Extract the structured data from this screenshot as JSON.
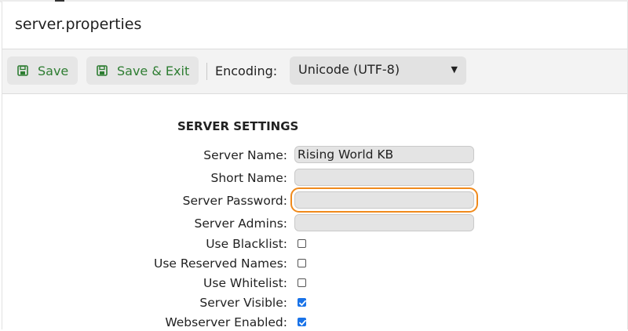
{
  "window": {
    "title": "server.properties"
  },
  "toolbar": {
    "save_label": "Save",
    "save_exit_label": "Save & Exit",
    "encoding_label": "Encoding:",
    "encoding_value": "Unicode (UTF-8)",
    "save_icon": "floppy-disk-icon"
  },
  "section": {
    "title": "SERVER SETTINGS",
    "fields": [
      {
        "label": "Server Name:",
        "value": "Rising World KB"
      },
      {
        "label": "Short Name:",
        "value": ""
      },
      {
        "label": "Server Password:",
        "value": ""
      },
      {
        "label": "Server Admins:",
        "value": ""
      }
    ],
    "checkboxes": [
      {
        "label": "Use Blacklist:",
        "checked": false
      },
      {
        "label": "Use Reserved Names:",
        "checked": false
      },
      {
        "label": "Use Whitelist:",
        "checked": false
      },
      {
        "label": "Server Visible:",
        "checked": true
      },
      {
        "label": "Webserver Enabled:",
        "checked": true
      }
    ]
  },
  "colors": {
    "accent_green": "#2e7d32",
    "focus_orange": "#f08a1c",
    "checkbox_blue": "#1a73e8"
  }
}
